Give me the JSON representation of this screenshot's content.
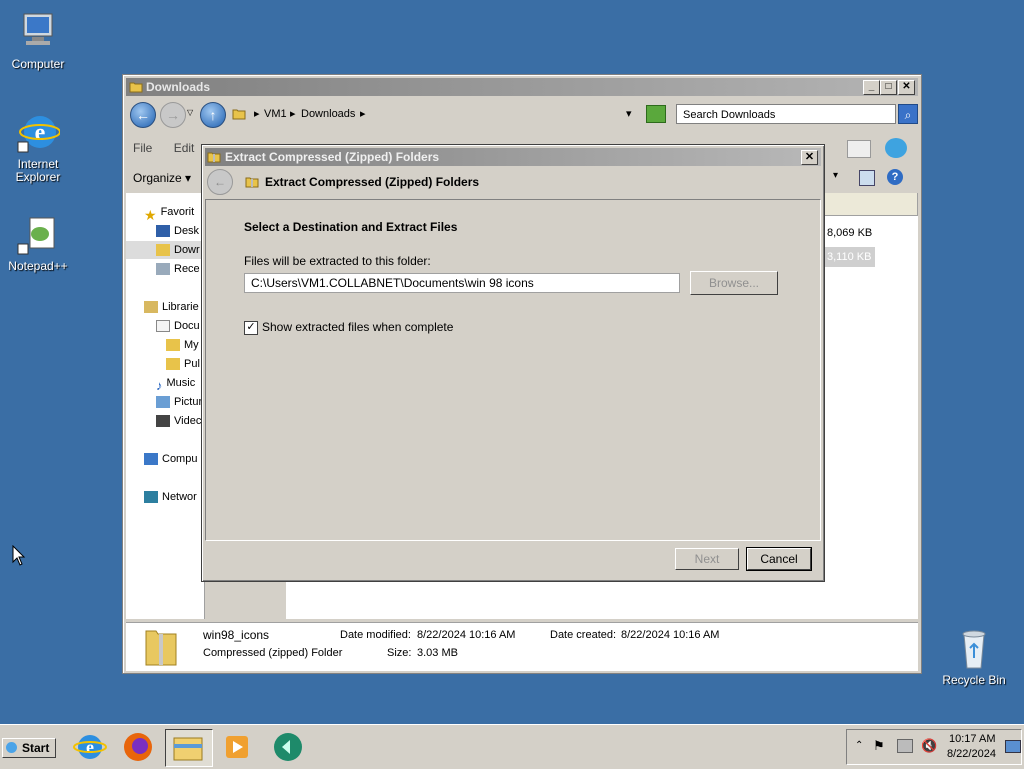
{
  "desktop": {
    "icons": [
      {
        "label": "Computer"
      },
      {
        "label": "Internet Explorer"
      },
      {
        "label": "Notepad++"
      },
      {
        "label": "Recycle Bin"
      }
    ]
  },
  "explorer": {
    "title": "Downloads",
    "address": {
      "segments": [
        "VM1",
        "Downloads"
      ]
    },
    "search_placeholder": "Search Downloads",
    "menu": [
      "File",
      "Edit"
    ],
    "organize_label": "Organize",
    "nav_items": [
      {
        "label": "Favorit",
        "icon": "star-icon"
      },
      {
        "label": "Desk",
        "icon": "desktop-icon"
      },
      {
        "label": "Dowr",
        "icon": "folder-icon"
      },
      {
        "label": "Rece",
        "icon": "recent-icon"
      },
      {
        "label": "Librarie",
        "icon": "libraries-icon"
      },
      {
        "label": "Docu",
        "icon": "document-icon"
      },
      {
        "label": "My",
        "icon": "folder-icon"
      },
      {
        "label": "Pul",
        "icon": "folder-icon"
      },
      {
        "label": "Music",
        "icon": "music-icon"
      },
      {
        "label": "Pictur",
        "icon": "pictures-icon"
      },
      {
        "label": "Videc",
        "icon": "videos-icon"
      },
      {
        "label": "Compu",
        "icon": "computer-icon"
      },
      {
        "label": "Networ",
        "icon": "network-icon"
      }
    ],
    "file_sizes": [
      "8,069 KB",
      "3,110 KB"
    ],
    "details": {
      "name": "win98_icons",
      "type": "Compressed (zipped) Folder",
      "modified_label": "Date modified:",
      "modified_value": "8/22/2024 10:16 AM",
      "created_label": "Date created:",
      "created_value": "8/22/2024 10:16 AM",
      "size_label": "Size:",
      "size_value": "3.03 MB"
    }
  },
  "dialog": {
    "title": "Extract Compressed (Zipped) Folders",
    "header": "Extract Compressed (Zipped) Folders",
    "section_title": "Select a Destination and Extract Files",
    "path_label": "Files will be extracted to this folder:",
    "path_value": "C:\\Users\\VM1.COLLABNET\\Documents\\win 98 icons",
    "browse_label": "Browse...",
    "checkbox_label": "Show extracted files when complete",
    "checkbox_checked": true,
    "next_label": "Next",
    "cancel_label": "Cancel"
  },
  "taskbar": {
    "start_label": "Start",
    "time": "10:17 AM",
    "date": "8/22/2024"
  },
  "colors": {
    "desktop": "#3a6ea5",
    "window_face": "#d4d0c8",
    "title_inactive": "#808080"
  }
}
